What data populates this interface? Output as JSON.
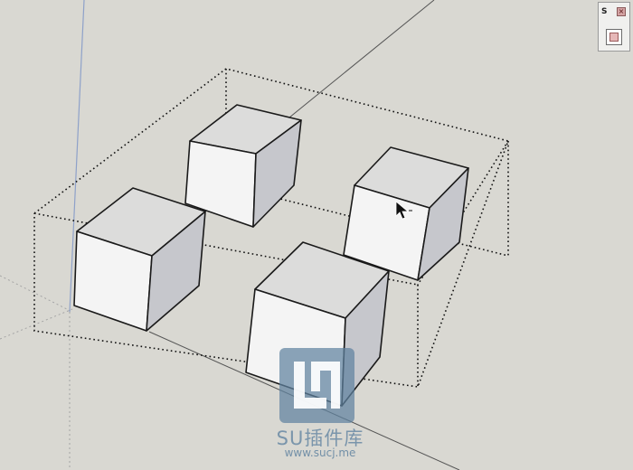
{
  "mini_window": {
    "title": "S",
    "close_glyph": "×",
    "button_icon": "component-icon"
  },
  "scene": {
    "objects": [
      "cube",
      "cube",
      "cube",
      "cube"
    ],
    "selection": "dotted-bounding-box",
    "cursor": "arrow-cursor-icon"
  },
  "watermark": {
    "title": "SU插件库",
    "url": "www.sucj.me"
  },
  "colors": {
    "background": "#d9d8d2",
    "cube_front": "#f4f4f4",
    "cube_top": "#dcdcdb",
    "cube_side": "#c6c7cc",
    "watermark": "#5f82a0"
  }
}
